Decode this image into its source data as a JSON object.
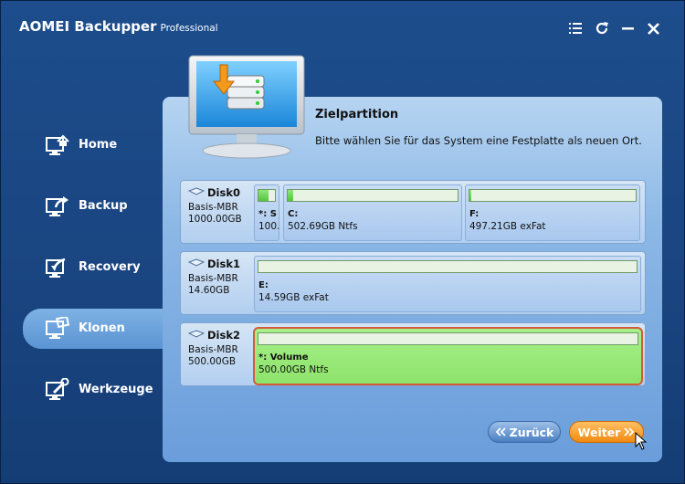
{
  "app": {
    "title": "AOMEI Backupper",
    "edition": "Professional"
  },
  "nav": {
    "items": [
      {
        "label": "Home",
        "icon": "home-icon"
      },
      {
        "label": "Backup",
        "icon": "backup-icon"
      },
      {
        "label": "Recovery",
        "icon": "recovery-icon"
      },
      {
        "label": "Klonen",
        "icon": "clone-icon",
        "active": true
      },
      {
        "label": "Werkzeuge",
        "icon": "tools-icon"
      }
    ]
  },
  "panel": {
    "title": "Zielpartition",
    "description": "Bitte wählen Sie für das System eine Festplatte als neuen Ort."
  },
  "disks": [
    {
      "name": "Disk0",
      "type": "Basis-MBR",
      "size": "1000.00GB",
      "partitions": [
        {
          "label": "*: S",
          "detail": "100.",
          "used": 0.6
        },
        {
          "label": "C:",
          "detail": "502.69GB Ntfs",
          "used": 0.03
        },
        {
          "label": "F:",
          "detail": "497.21GB exFat",
          "used": 0.01
        }
      ]
    },
    {
      "name": "Disk1",
      "type": "Basis-MBR",
      "size": "14.60GB",
      "partitions": [
        {
          "label": "E:",
          "detail": "14.59GB exFat",
          "used": 0.0
        }
      ]
    },
    {
      "name": "Disk2",
      "type": "Basis-MBR",
      "size": "500.00GB",
      "partitions": [
        {
          "label": "*: Volume",
          "detail": "500.00GB Ntfs",
          "used": 0.0,
          "selected": true
        }
      ]
    }
  ],
  "buttons": {
    "back": "Zurück",
    "next": "Weiter"
  },
  "colors": {
    "accent_next": "#f08a12",
    "selection_border": "#d35a3b",
    "partition_selected": "#8ee36b"
  }
}
